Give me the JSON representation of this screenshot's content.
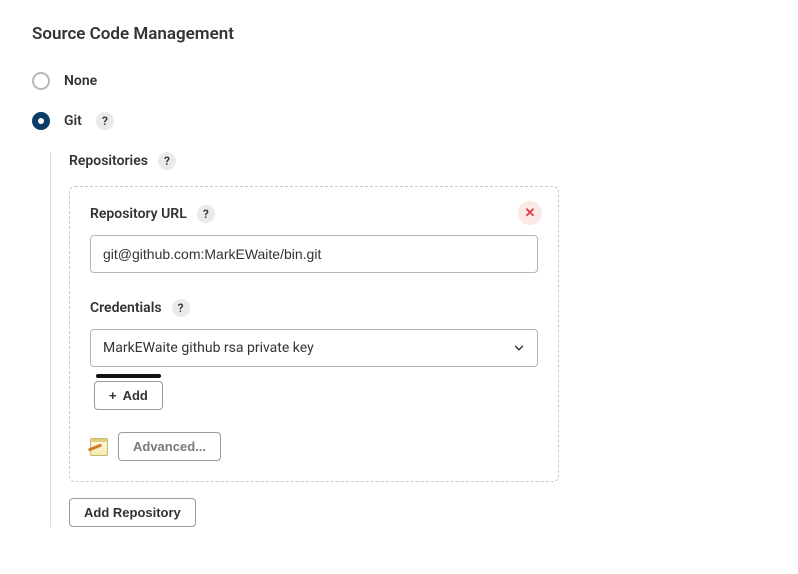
{
  "heading": "Source Code Management",
  "scm_options": {
    "none": {
      "label": "None",
      "selected": false
    },
    "git": {
      "label": "Git",
      "selected": true
    }
  },
  "repositories": {
    "title": "Repositories",
    "entries": [
      {
        "repository_url": {
          "label": "Repository URL",
          "value": "git@github.com:MarkEWaite/bin.git"
        },
        "credentials": {
          "label": "Credentials",
          "selected": "MarkEWaite github rsa private key",
          "add_label": "Add"
        },
        "advanced_label": "Advanced..."
      }
    ],
    "add_repo_label": "Add Repository"
  }
}
